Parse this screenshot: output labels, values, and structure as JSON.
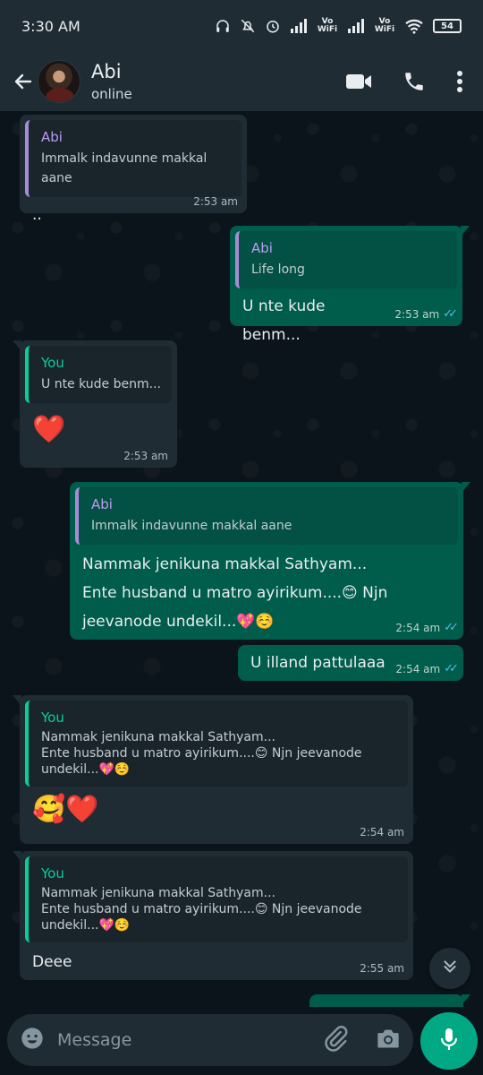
{
  "status_bar": {
    "time": "3:30 AM",
    "vowifi_1": "Vo WiFi",
    "vowifi_2": "Vo WiFi",
    "battery": "54"
  },
  "header": {
    "contact_name": "Abi",
    "contact_status": "online"
  },
  "messages": [
    {
      "direction": "in",
      "quote_author": "Abi",
      "quote_text": "Immalk indavunne makkal aane",
      "text": "..",
      "time": "2:53 am"
    },
    {
      "direction": "out",
      "quote_author": "Abi",
      "quote_text": "Life long",
      "text": "U nte kude benm...",
      "time": "2:53 am"
    },
    {
      "direction": "in",
      "quote_author": "You",
      "quote_text": "U nte kude benm...",
      "text": "❤️",
      "time": "2:53 am"
    },
    {
      "direction": "out",
      "quote_author": "Abi",
      "quote_text": "Immalk indavunne makkal aane",
      "text_line1": "Nammak jenikuna makkal Sathyam...",
      "text_line2": "Ente husband u matro ayirikum....😊 Njn",
      "text_line3": "jeevanode undekil...💖☺️",
      "time": "2:54 am"
    },
    {
      "direction": "out",
      "text": "U illand pattulaaa",
      "time": "2:54 am"
    },
    {
      "direction": "in",
      "quote_author": "You",
      "quote_line1": "Nammak jenikuna makkal Sathyam...",
      "quote_line2": "Ente husband u matro ayirikum....😊 Njn jeevanode",
      "quote_line3": "undekil...💖☺️",
      "text": "🥰❤️",
      "time": "2:54 am"
    },
    {
      "direction": "in",
      "quote_author": "You",
      "quote_line1": "Nammak jenikuna makkal Sathyam...",
      "quote_line2": "Ente husband u matro ayirikum....😊 Njn jeevanode",
      "quote_line3": "undekil...💖☺️",
      "text": "Deee",
      "time": "2:55 am"
    }
  ],
  "input": {
    "placeholder": "Message"
  },
  "colors": {
    "header_bg": "#1f2c34",
    "chat_bg": "#0b141a",
    "incoming_bubble": "#1f2c34",
    "outgoing_bubble": "#005c4b",
    "accent": "#00a884",
    "read_ticks": "#53bdeb"
  },
  "icons": [
    "back-arrow-icon",
    "video-call-icon",
    "phone-icon",
    "more-vert-icon",
    "emoji-icon",
    "attach-icon",
    "camera-icon",
    "mic-icon",
    "double-chevron-down-icon"
  ]
}
